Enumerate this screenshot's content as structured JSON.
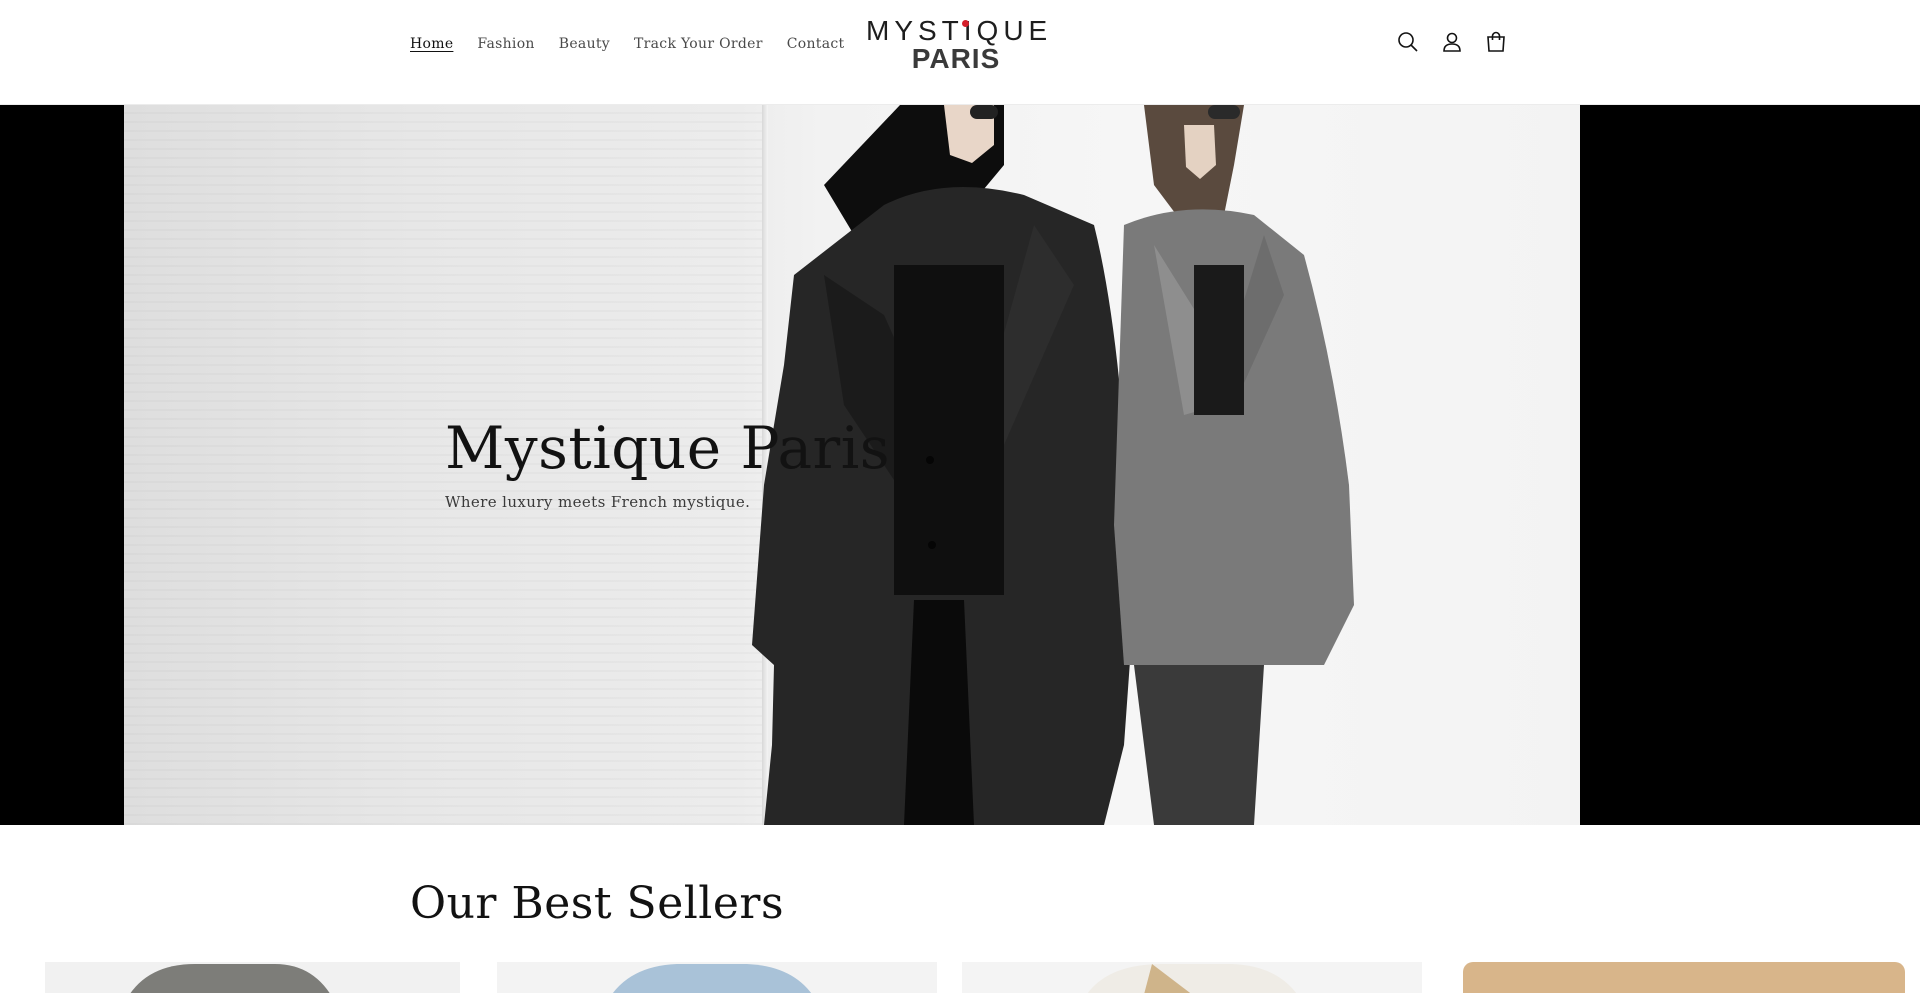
{
  "header": {
    "nav": [
      {
        "label": "Home",
        "active": true
      },
      {
        "label": "Fashion",
        "active": false
      },
      {
        "label": "Beauty",
        "active": false
      },
      {
        "label": "Track Your Order",
        "active": false
      },
      {
        "label": "Contact",
        "active": false
      }
    ],
    "logo": {
      "line1": "MYSTIQUE",
      "line2": "PARIS"
    },
    "icons": [
      "search-icon",
      "account-icon",
      "cart-icon"
    ]
  },
  "hero": {
    "title": "Mystique Paris",
    "subtitle": "Where luxury meets French mystique."
  },
  "best_sellers": {
    "title": "Our Best Sellers",
    "products": [
      {
        "image": "grey-shirt-model"
      },
      {
        "image": "light-blue-shirt-model"
      },
      {
        "image": "white-blouse-model"
      },
      {
        "image": "tan-background-product"
      }
    ]
  },
  "colors": {
    "accent_red": "#d41f2a",
    "text": "#121212",
    "hero_side": "#000000"
  }
}
